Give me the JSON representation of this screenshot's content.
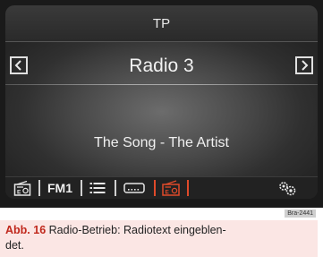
{
  "screen": {
    "top_title": "TP",
    "station_name": "Radio 3",
    "radio_text": "The Song - The Artist",
    "prev_icon": "chevron-left-icon",
    "next_icon": "chevron-right-icon",
    "bottom_bar": {
      "source_icon": "radio-source-icon",
      "band_label": "FM1",
      "list_icon": "station-list-icon",
      "presets_icon": "memory-presets-icon",
      "active_icon": "radio-active-icon",
      "settings_icon": "gears-icon",
      "active_color": "#e04a2a"
    }
  },
  "figure_code": "Bra-2441",
  "caption": {
    "number": "Abb. 16",
    "text": "Radio-Betrieb: Radiotext eingeblen-\ndet."
  }
}
